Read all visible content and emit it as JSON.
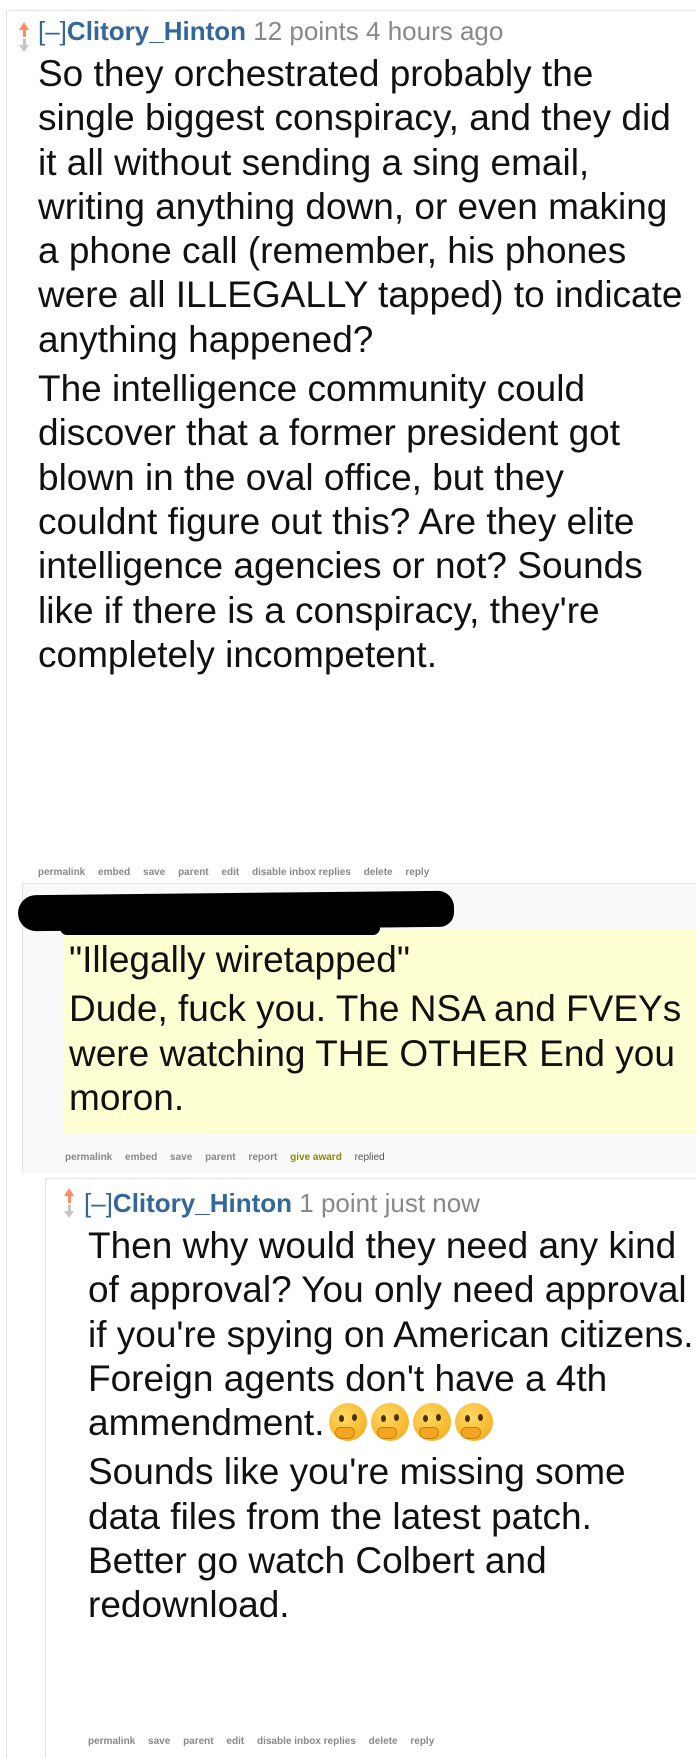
{
  "comment1": {
    "collapse": "[–]",
    "author": "Clitory_Hinton",
    "score": "12 points",
    "age": "4 hours ago",
    "paragraphs": [
      "So they orchestrated probably the single biggest conspiracy, and they did it all without sending a sing email, writing anything down, or even making a phone call (remember, his phones were all ILLEGALLY tapped) to indicate anything happened?",
      "The intelligence community could discover that a former president got blown in the oval office, but they couldnt figure out this? Are they elite intelligence agencies or not? Sounds like if there is a conspiracy, they're completely incompetent."
    ],
    "buttons": [
      "permalink",
      "embed",
      "save",
      "parent",
      "edit",
      "disable inbox replies",
      "delete",
      "reply"
    ]
  },
  "comment2": {
    "paragraphs": [
      "\"Illegally wiretapped\"",
      "Dude, fuck you. The NSA and FVEYs were watching THE OTHER End you moron."
    ],
    "buttons": [
      "permalink",
      "embed",
      "save",
      "parent",
      "report"
    ],
    "award": "give award",
    "replied": "replied"
  },
  "comment3": {
    "collapse": "[–]",
    "author": "Clitory_Hinton",
    "score": "1 point",
    "age": "just now",
    "p1": "Then why would they need any kind of approval? You only need approval if you're spying on American citizens. Foreign agents don't have a 4th ammendment.",
    "emoji_icon": "thinking-face",
    "emoji_count": 4,
    "p2": "Sounds like you're missing some data files from the latest patch. Better go watch Colbert and redownload.",
    "buttons": [
      "permalink",
      "save",
      "parent",
      "edit",
      "disable inbox replies",
      "delete",
      "reply"
    ]
  },
  "colors": {
    "upvote": "#ff8b60",
    "author": "#336699",
    "highlight": "#ffffd4",
    "award": "#8b8b00"
  }
}
